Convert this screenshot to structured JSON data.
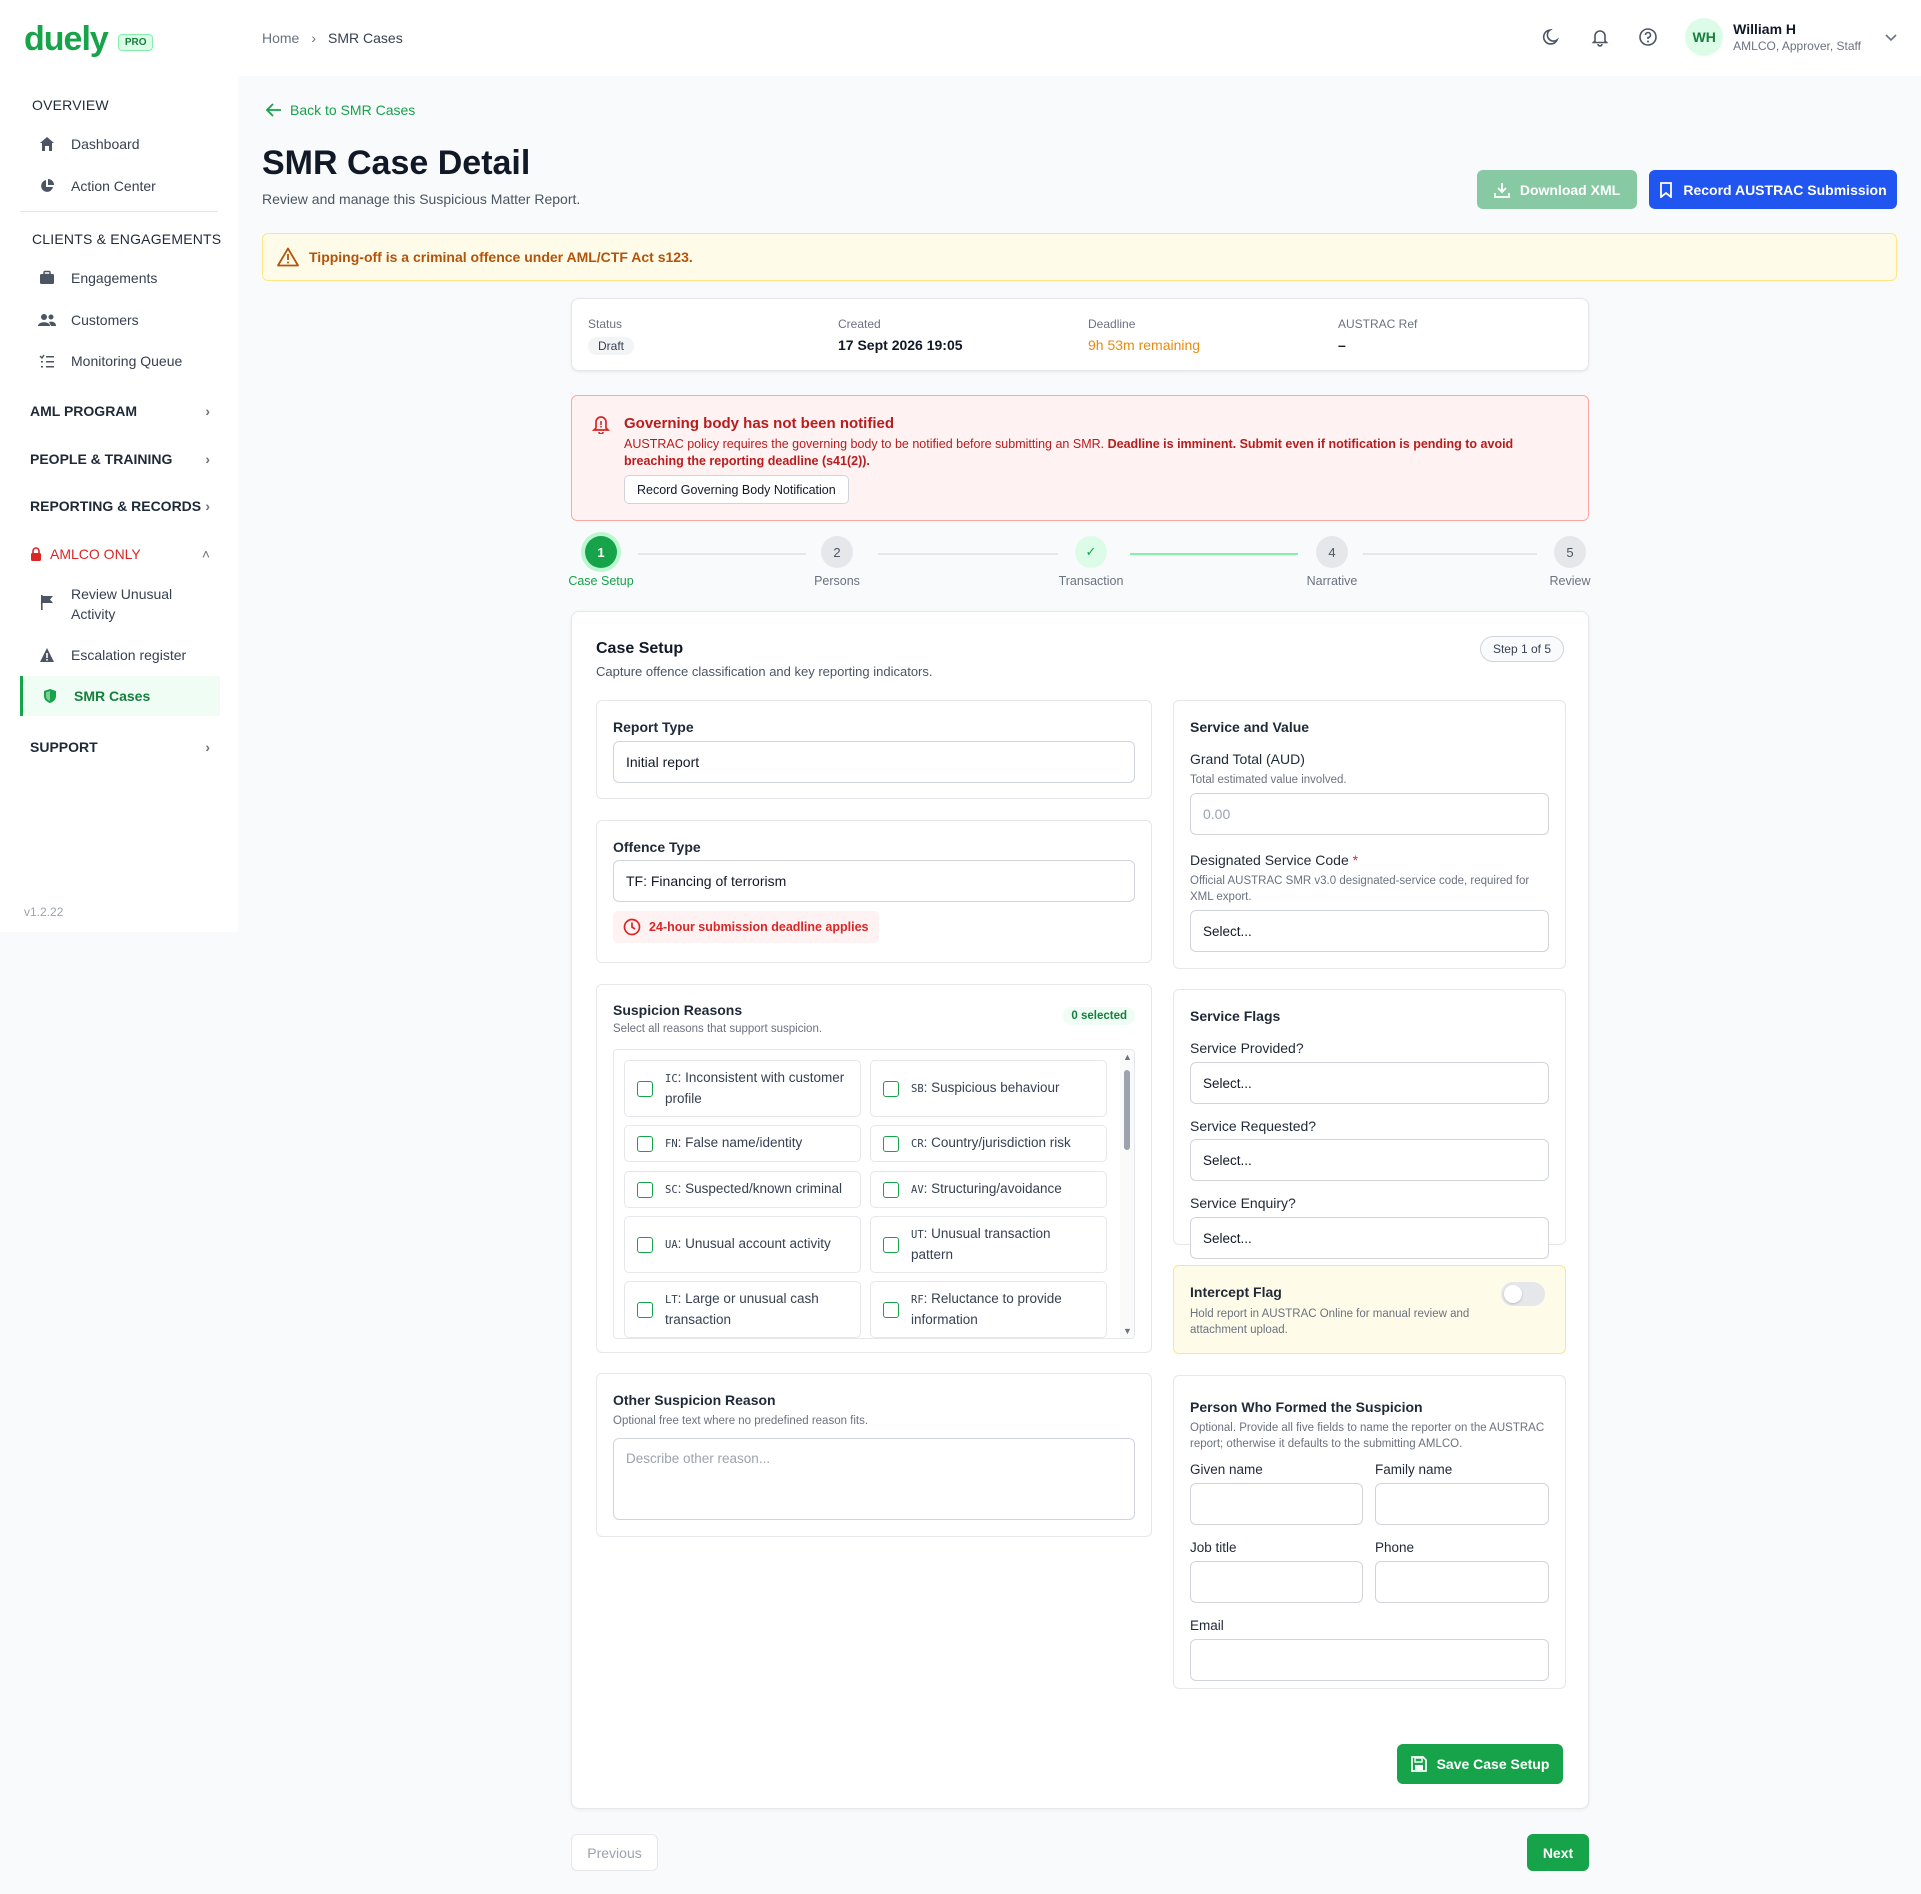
{
  "brand": {
    "name": "duely",
    "badge": "PRO",
    "version": "v1.2.22"
  },
  "sidebar": {
    "overview": "OVERVIEW",
    "overview_items": [
      {
        "label": "Dashboard",
        "icon": "home-icon"
      },
      {
        "label": "Action Center",
        "icon": "pie-chart-icon"
      }
    ],
    "clients": "CLIENTS & ENGAGEMENTS",
    "clients_items": [
      {
        "label": "Engagements",
        "icon": "briefcase-icon"
      },
      {
        "label": "Customers",
        "icon": "users-icon"
      },
      {
        "label": "Monitoring Queue",
        "icon": "list-check-icon"
      }
    ],
    "aml_program": "AML PROGRAM",
    "people_training": "PEOPLE & TRAINING",
    "reporting_records": "REPORTING & RECORDS",
    "amlco_only": "AMLCO ONLY",
    "amlco_items": [
      {
        "label": "Review Unusual Activity",
        "icon": "flag-icon"
      },
      {
        "label": "Escalation register",
        "icon": "warning-icon"
      },
      {
        "label": "SMR Cases",
        "icon": "shield-icon"
      }
    ],
    "support": "SUPPORT"
  },
  "header": {
    "breadcrumb": [
      "Home",
      "SMR Cases"
    ],
    "user": {
      "initials": "WH",
      "name": "William H",
      "role": "AMLCO, Approver, Staff"
    }
  },
  "page": {
    "back_label": "Back to SMR Cases",
    "title": "SMR Case Detail",
    "subtitle": "Review and manage this Suspicious Matter Report.",
    "download_xml": "Download XML",
    "record_submission": "Record AUSTRAC Submission",
    "tipping_warning": "Tipping-off is a criminal offence under AML/CTF Act s123."
  },
  "status": {
    "status_label": "Status",
    "status_value": "Draft",
    "created_label": "Created",
    "created_value": "17 Sept 2026 19:05",
    "deadline_label": "Deadline",
    "deadline_value": "9h 53m remaining",
    "ref_label": "AUSTRAC Ref",
    "ref_value": "–"
  },
  "alert": {
    "title": "Governing body has not been notified",
    "body_plain": "AUSTRAC policy requires the governing body to be notified before submitting an SMR. ",
    "body_bold": "Deadline is imminent. Submit even if notification is pending to avoid breaching the reporting deadline (s41(2)).",
    "button": "Record Governing Body Notification"
  },
  "steps": [
    {
      "num": "1",
      "label": "Case Setup",
      "state": "active"
    },
    {
      "num": "2",
      "label": "Persons",
      "state": "todo"
    },
    {
      "num": "✓",
      "label": "Transaction",
      "state": "done"
    },
    {
      "num": "4",
      "label": "Narrative",
      "state": "todo"
    },
    {
      "num": "5",
      "label": "Review",
      "state": "todo"
    }
  ],
  "case_setup": {
    "title": "Case Setup",
    "subtitle": "Capture offence classification and key reporting indicators.",
    "step_badge": "Step 1 of 5",
    "report_type_label": "Report Type",
    "report_type_value": "Initial report",
    "offence_type_label": "Offence Type",
    "offence_type_value": "TF: Financing of terrorism",
    "deadline_chip": "24-hour submission deadline applies",
    "suspicion_title": "Suspicion Reasons",
    "suspicion_hint": "Select all reasons that support suspicion.",
    "selected_badge": "0 selected",
    "reasons": [
      {
        "code": "IC",
        "label": ": Inconsistent with customer profile"
      },
      {
        "code": "SB",
        "label": ": Suspicious behaviour"
      },
      {
        "code": "FN",
        "label": ": False name/identity"
      },
      {
        "code": "CR",
        "label": ": Country/jurisdiction risk"
      },
      {
        "code": "SC",
        "label": ": Suspected/known criminal"
      },
      {
        "code": "AV",
        "label": ": Structuring/avoidance"
      },
      {
        "code": "UA",
        "label": ": Unusual account activity"
      },
      {
        "code": "UT",
        "label": ": Unusual transaction pattern"
      },
      {
        "code": "LT",
        "label": ": Large or unusual cash transaction"
      },
      {
        "code": "RF",
        "label": ": Reluctance to provide information"
      }
    ],
    "other_title": "Other Suspicion Reason",
    "other_hint": "Optional free text where no predefined reason fits.",
    "other_placeholder": "Describe other reason...",
    "service_value_title": "Service and Value",
    "grand_total_label": "Grand Total (AUD)",
    "grand_total_hint": "Total estimated value involved.",
    "grand_total_placeholder": "0.00",
    "service_code_label": "Designated Service Code",
    "service_code_req": "*",
    "service_code_hint": "Official AUSTRAC SMR v3.0 designated-service code, required for XML export.",
    "service_code_value": "Select...",
    "flags_title": "Service Flags",
    "provided_label": "Service Provided?",
    "provided_value": "Select...",
    "requested_label": "Service Requested?",
    "requested_value": "Select...",
    "enquiry_label": "Service Enquiry?",
    "enquiry_value": "Select...",
    "intercept_title": "Intercept Flag",
    "intercept_hint": "Hold report in AUSTRAC Online for manual review and attachment upload.",
    "intercept_on": false,
    "person_title": "Person Who Formed the Suspicion",
    "person_hint": "Optional. Provide all five fields to name the reporter on the AUSTRAC report; otherwise it defaults to the submitting AMLCO.",
    "given_label": "Given name",
    "family_label": "Family name",
    "job_label": "Job title",
    "phone_label": "Phone",
    "email_label": "Email",
    "save_button": "Save Case Setup"
  },
  "footer": {
    "previous": "Previous",
    "next": "Next"
  },
  "colors": {
    "brand": "#16a34a",
    "primary": "#2155f0",
    "danger": "#dc2626",
    "warning": "#b45309"
  }
}
